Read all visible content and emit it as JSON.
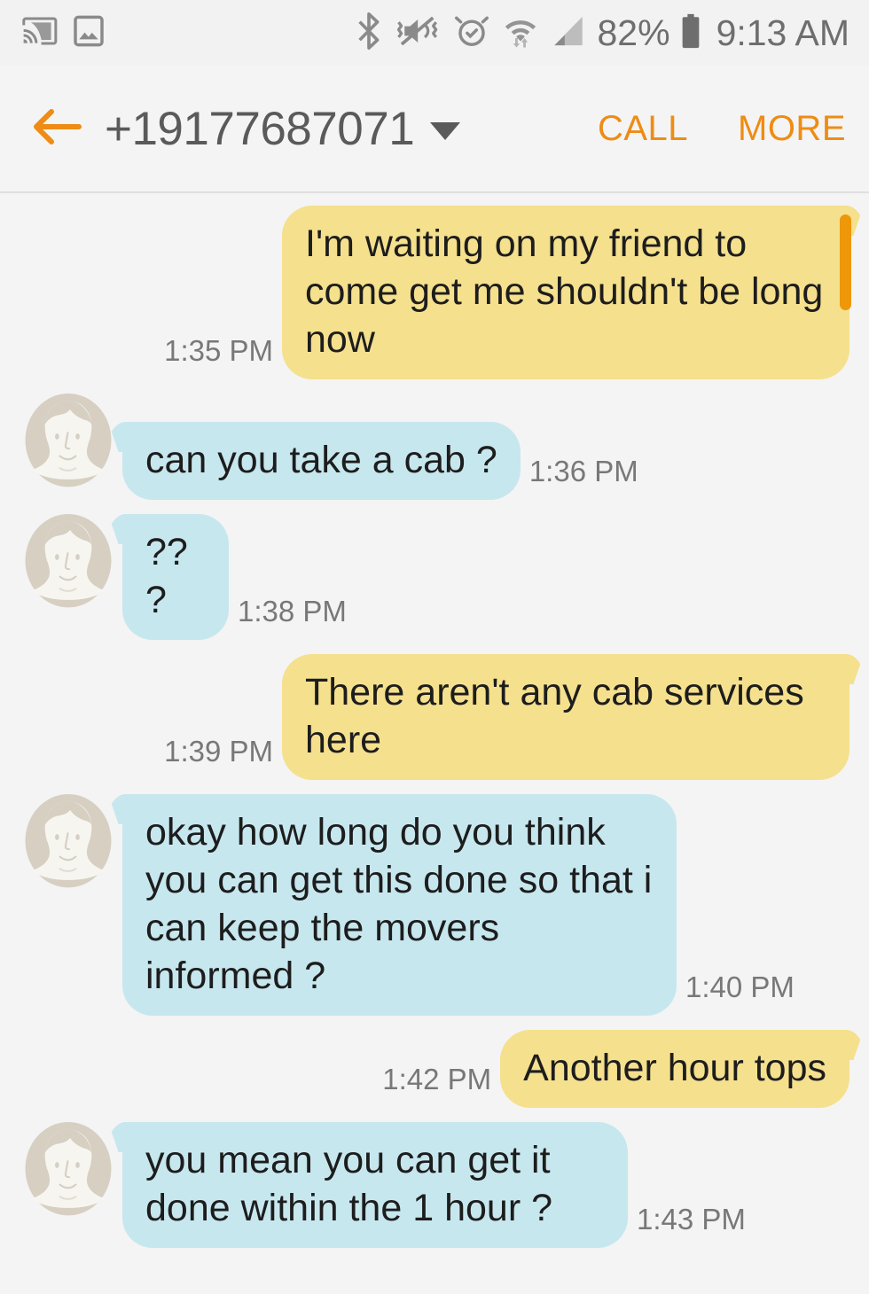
{
  "status_bar": {
    "left_icons": [
      "cast-icon",
      "screenshot-image-icon"
    ],
    "right_icons": [
      "bluetooth-icon",
      "vibrate-mute-icon",
      "alarm-icon",
      "wifi-data-icon",
      "signal-bars-icon",
      "battery-icon"
    ],
    "battery_percent": "82%",
    "clock": "9:13 AM"
  },
  "header": {
    "back_icon": "back-arrow-icon",
    "title": "+19177687071",
    "dropdown_icon": "chevron-down-icon",
    "call_label": "CALL",
    "more_label": "MORE",
    "accent_color": "#ee8c15",
    "title_color": "#5a5a5a"
  },
  "conversation": {
    "bubble_colors": {
      "incoming": "#c7e7ee",
      "outgoing": "#f5e08d"
    },
    "scrollbar_color": "#ed9709",
    "messages": [
      {
        "direction": "outgoing",
        "text": "I'm waiting on my friend to come get me shouldn't be long now",
        "time": "1:35 PM",
        "avatar": false
      },
      {
        "direction": "incoming",
        "text": "can you take a cab ?",
        "time": "1:36 PM",
        "avatar": true
      },
      {
        "direction": "incoming",
        "text": "???",
        "time": "1:38 PM",
        "avatar": true
      },
      {
        "direction": "outgoing",
        "text": "There aren't any cab services here",
        "time": "1:39 PM",
        "avatar": false
      },
      {
        "direction": "incoming",
        "text": "okay how long do you think you can get this done so that i can keep the movers informed ?",
        "time": "1:40 PM",
        "avatar": true
      },
      {
        "direction": "outgoing",
        "text": "Another hour tops",
        "time": "1:42 PM",
        "avatar": false
      },
      {
        "direction": "incoming",
        "text": "you mean you can get it done within the 1 hour ?",
        "time": "1:43 PM",
        "avatar": true
      }
    ]
  }
}
